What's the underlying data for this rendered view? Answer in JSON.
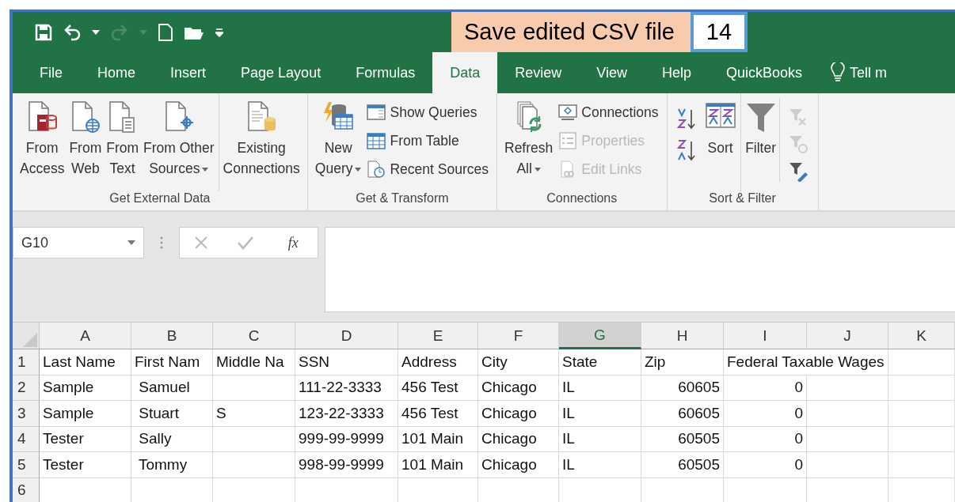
{
  "callout": {
    "text": "Save edited CSV file",
    "step": "14"
  },
  "tabs": [
    {
      "label": "File",
      "selected": false
    },
    {
      "label": "Home",
      "selected": false
    },
    {
      "label": "Insert",
      "selected": false
    },
    {
      "label": "Page Layout",
      "selected": false
    },
    {
      "label": "Formulas",
      "selected": false
    },
    {
      "label": "Data",
      "selected": true
    },
    {
      "label": "Review",
      "selected": false
    },
    {
      "label": "View",
      "selected": false
    },
    {
      "label": "Help",
      "selected": false
    },
    {
      "label": "QuickBooks",
      "selected": false
    }
  ],
  "tell_me": "Tell m",
  "ribbon": {
    "groups": [
      {
        "label": "Get External Data",
        "sections": [
          [
            {
              "kind": "large",
              "label": "From\nAccess",
              "dropdown": false
            },
            {
              "kind": "large",
              "label": "From\nWeb",
              "dropdown": false
            },
            {
              "kind": "large",
              "label": "From\nText",
              "dropdown": false
            },
            {
              "kind": "large",
              "label": "From Other\nSources",
              "dropdown": true
            }
          ],
          [
            {
              "kind": "large",
              "label": "Existing\nConnections",
              "dropdown": false
            }
          ]
        ]
      },
      {
        "label": "Get & Transform",
        "sections": [
          [
            {
              "kind": "large",
              "label": "New\nQuery",
              "dropdown": true
            },
            {
              "kind": "stack",
              "items": [
                {
                  "label": "Show Queries",
                  "disabled": false
                },
                {
                  "label": "From Table",
                  "disabled": false
                },
                {
                  "label": "Recent Sources",
                  "disabled": false
                }
              ]
            }
          ]
        ]
      },
      {
        "label": "Connections",
        "sections": [
          [
            {
              "kind": "large",
              "label": "Refresh\nAll",
              "dropdown": true
            },
            {
              "kind": "stack",
              "items": [
                {
                  "label": "Connections",
                  "disabled": false
                },
                {
                  "label": "Properties",
                  "disabled": true
                },
                {
                  "label": "Edit Links",
                  "disabled": true
                }
              ]
            }
          ]
        ]
      },
      {
        "label": "Sort & Filter",
        "sections": [
          [
            {
              "kind": "sort_icons"
            },
            {
              "kind": "large",
              "label": "Sort",
              "dropdown": false
            }
          ],
          [
            {
              "kind": "large",
              "label": "Filter",
              "dropdown": false
            },
            {
              "kind": "filter_icons"
            }
          ]
        ]
      }
    ]
  },
  "formula_bar": {
    "name_box": "G10",
    "function_button": "fx"
  },
  "sheet": {
    "columns": [
      {
        "letter": "A",
        "selected": false
      },
      {
        "letter": "B",
        "selected": false
      },
      {
        "letter": "C",
        "selected": false
      },
      {
        "letter": "D",
        "selected": false
      },
      {
        "letter": "E",
        "selected": false
      },
      {
        "letter": "F",
        "selected": false
      },
      {
        "letter": "G",
        "selected": true
      },
      {
        "letter": "H",
        "selected": false
      },
      {
        "letter": "I",
        "selected": false
      },
      {
        "letter": "J",
        "selected": false
      },
      {
        "letter": "K",
        "selected": false
      }
    ],
    "rows": [
      {
        "number": "1",
        "kind": "header",
        "cells": [
          {
            "text": "Last Name",
            "numeric": false
          },
          {
            "text": "First Nam",
            "numeric": false
          },
          {
            "text": "Middle Na",
            "numeric": false
          },
          {
            "text": "SSN",
            "numeric": false
          },
          {
            "text": "Address",
            "numeric": false
          },
          {
            "text": "City",
            "numeric": false
          },
          {
            "text": "State",
            "numeric": false
          },
          {
            "text": "Zip",
            "numeric": false
          },
          {
            "text": "Federal Taxable Wages",
            "numeric": false
          },
          null,
          null
        ]
      },
      {
        "number": "2",
        "kind": "data",
        "cells": [
          {
            "text": "Sample",
            "numeric": false
          },
          {
            "text": " Samuel",
            "numeric": false
          },
          null,
          {
            "text": "111-22-3333",
            "numeric": false
          },
          {
            "text": "456 Test",
            "numeric": false
          },
          {
            "text": "Chicago",
            "numeric": false
          },
          {
            "text": "IL",
            "numeric": false
          },
          {
            "text": "60605",
            "numeric": true
          },
          {
            "text": "0",
            "numeric": true
          },
          null,
          null
        ]
      },
      {
        "number": "3",
        "kind": "data",
        "cells": [
          {
            "text": "Sample",
            "numeric": false
          },
          {
            "text": " Stuart",
            "numeric": false
          },
          {
            "text": "S",
            "numeric": false
          },
          {
            "text": "123-22-3333",
            "numeric": false
          },
          {
            "text": "456 Test",
            "numeric": false
          },
          {
            "text": "Chicago",
            "numeric": false
          },
          {
            "text": "IL",
            "numeric": false
          },
          {
            "text": "60605",
            "numeric": true
          },
          {
            "text": "0",
            "numeric": true
          },
          null,
          null
        ]
      },
      {
        "number": "4",
        "kind": "data",
        "cells": [
          {
            "text": "Tester",
            "numeric": false
          },
          {
            "text": " Sally",
            "numeric": false
          },
          null,
          {
            "text": "999-99-9999",
            "numeric": false
          },
          {
            "text": "101 Main",
            "numeric": false
          },
          {
            "text": "Chicago",
            "numeric": false
          },
          {
            "text": "IL",
            "numeric": false
          },
          {
            "text": "60505",
            "numeric": true
          },
          {
            "text": "0",
            "numeric": true
          },
          null,
          null
        ]
      },
      {
        "number": "5",
        "kind": "data",
        "cells": [
          {
            "text": "Tester",
            "numeric": false
          },
          {
            "text": " Tommy",
            "numeric": false
          },
          null,
          {
            "text": "998-99-9999",
            "numeric": false
          },
          {
            "text": "101 Main",
            "numeric": false
          },
          {
            "text": "Chicago",
            "numeric": false
          },
          {
            "text": "IL",
            "numeric": false
          },
          {
            "text": "60505",
            "numeric": true
          },
          {
            "text": "0",
            "numeric": true
          },
          null,
          null
        ]
      },
      {
        "number": "6",
        "kind": "data",
        "cells": [
          null,
          null,
          null,
          null,
          null,
          null,
          null,
          null,
          null,
          null,
          null
        ]
      }
    ]
  }
}
